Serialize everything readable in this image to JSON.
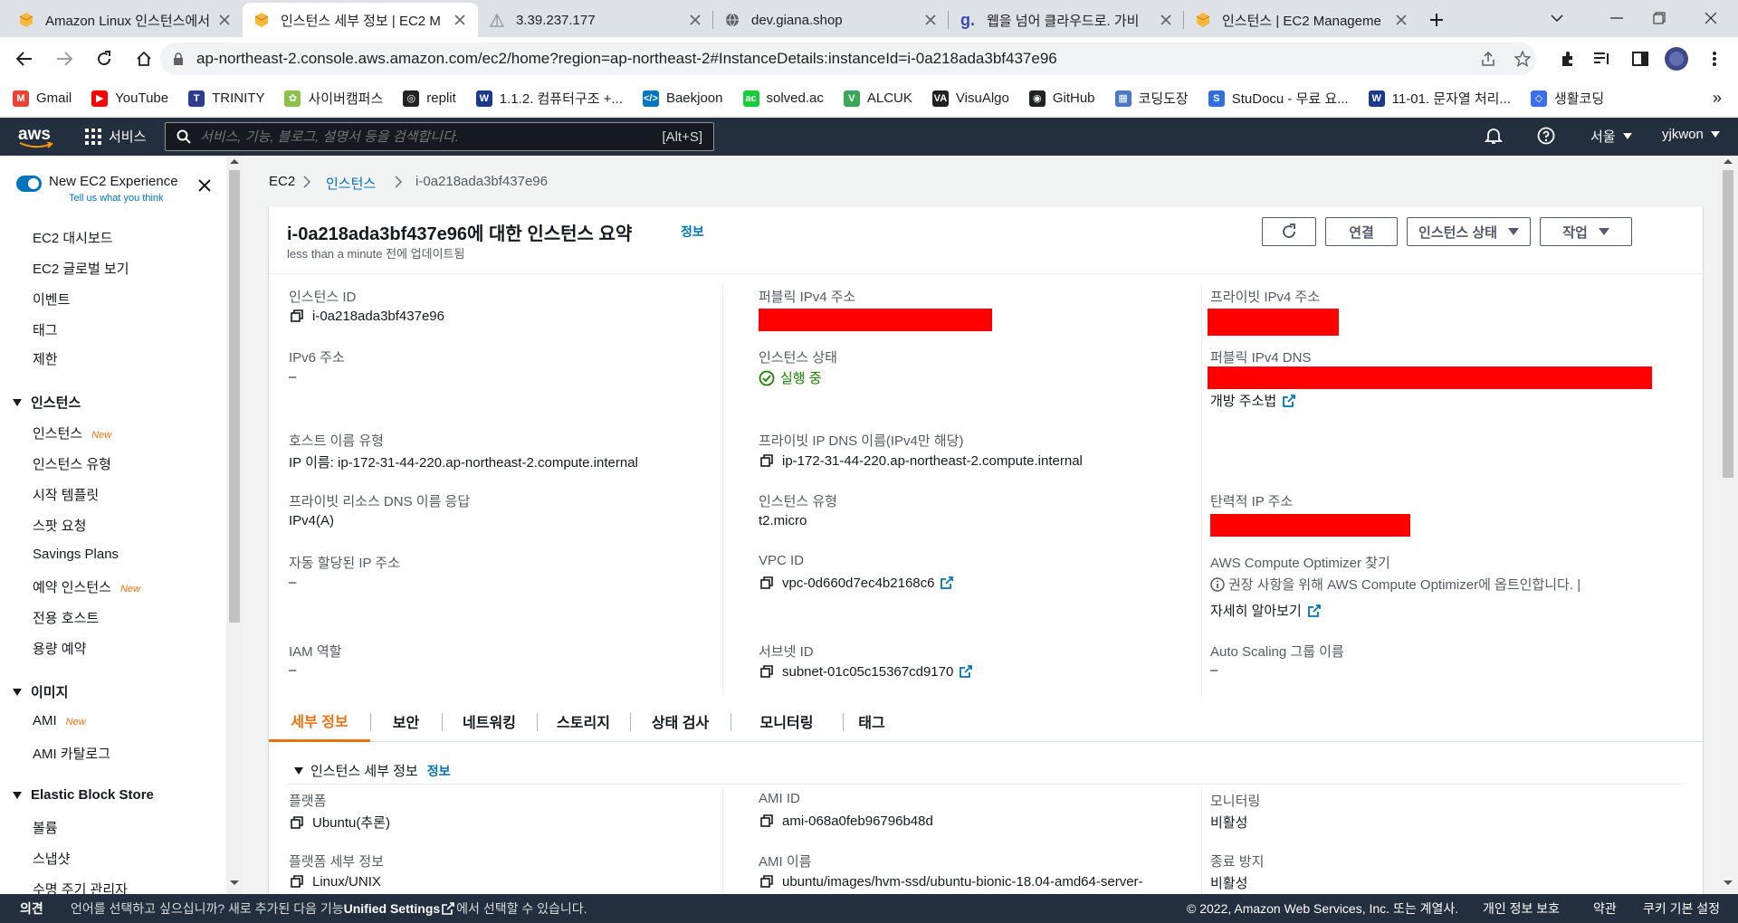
{
  "browser": {
    "tabs": [
      {
        "title": "Amazon Linux 인스턴스에서 A",
        "fav": "aws-box"
      },
      {
        "title": "인스턴스 세부 정보 | EC2 M",
        "fav": "aws-box"
      },
      {
        "title": "3.39.237.177",
        "fav": "tent"
      },
      {
        "title": "dev.giana.shop",
        "fav": "globe"
      },
      {
        "title": "웹을 넘어 클라우드로. 가비",
        "fav": "g"
      },
      {
        "title": "인스턴스 | EC2 Manageme",
        "fav": "aws-box"
      }
    ],
    "url": "ap-northeast-2.console.aws.amazon.com/ec2/home?region=ap-northeast-2#InstanceDetails:instanceId=i-0a218ada3bf437e96",
    "bookmarks": [
      {
        "label": "Gmail",
        "color": "#ea4335",
        "glyph": "M"
      },
      {
        "label": "YouTube",
        "color": "#ff0000",
        "glyph": "▶"
      },
      {
        "label": "TRINITY",
        "color": "#2c3e8c",
        "glyph": "T"
      },
      {
        "label": "사이버캠퍼스",
        "color": "#8bc34a",
        "glyph": "✿"
      },
      {
        "label": "replit",
        "color": "#202124",
        "glyph": "◎"
      },
      {
        "label": "1.1.2. 컴퓨터구조 +...",
        "color": "#1a3a8a",
        "glyph": "W"
      },
      {
        "label": "Baekjoon",
        "color": "#0076c0",
        "glyph": "</>"
      },
      {
        "label": "solved.ac",
        "color": "#17ce3a",
        "glyph": "ac"
      },
      {
        "label": "ALCUK",
        "color": "#3aa657",
        "glyph": "V"
      },
      {
        "label": "VisuAlgo",
        "color": "#202124",
        "glyph": "VA"
      },
      {
        "label": "GitHub",
        "color": "#202124",
        "glyph": "◉"
      },
      {
        "label": "코딩도장",
        "color": "#4a78c2",
        "glyph": "▦"
      },
      {
        "label": "StuDocu - 무료 요...",
        "color": "#2f6fdf",
        "glyph": "S"
      },
      {
        "label": "11-01. 문자열 처리...",
        "color": "#1a3a8a",
        "glyph": "W"
      },
      {
        "label": "생활코딩",
        "color": "#3d6ef0",
        "glyph": "◇"
      }
    ],
    "more_bookmarks": "»"
  },
  "aws": {
    "logo": "aws",
    "services": "서비스",
    "search_placeholder": "서비스, 기능, 블로그, 설명서 등을 검색합니다.",
    "search_shortcut": "[Alt+S]",
    "region": "서울",
    "user": "yjkwon"
  },
  "sidebar": {
    "new_experience": "New EC2 Experience",
    "tell_us": "Tell us what you think",
    "new_badge": "New",
    "items_top": [
      "EC2 대시보드",
      "EC2 글로벌 보기",
      "이벤트",
      "태그",
      "제한"
    ],
    "group_instances": "인스턴스",
    "items_instances": [
      "인스턴스",
      "인스턴스 유형",
      "시작 템플릿",
      "스팟 요청",
      "Savings Plans",
      "예약 인스턴스",
      "전용 호스트",
      "용량 예약"
    ],
    "group_images": "이미지",
    "items_images": [
      "AMI",
      "AMI 카탈로그"
    ],
    "group_ebs": "Elastic Block Store",
    "items_ebs": [
      "볼륨",
      "스냅샷",
      "수명 주기 관리자"
    ]
  },
  "breadcrumb": {
    "root": "EC2",
    "section": "인스턴스",
    "current": "i-0a218ada3bf437e96"
  },
  "summary": {
    "title": "i-0a218ada3bf437e96에 대한 인스턴스 요약",
    "info": "정보",
    "updated": "less than a minute 전에 업데이트됨",
    "btn_connect": "연결",
    "btn_state": "인스턴스 상태",
    "btn_actions": "작업"
  },
  "fields": {
    "instance_id_label": "인스턴스 ID",
    "instance_id": "i-0a218ada3bf437e96",
    "public_ipv4_label": "퍼블릭 IPv4 주소",
    "private_ipv4_label": "프라이빗 IPv4 주소",
    "ipv6_label": "IPv6 주소",
    "ipv6": "–",
    "state_label": "인스턴스 상태",
    "state": "실행 중",
    "public_dns_label": "퍼블릭 IPv4 DNS",
    "open_address": "개방 주소법",
    "hostname_type_label": "호스트 이름 유형",
    "hostname_type": "IP 이름: ip-172-31-44-220.ap-northeast-2.compute.internal",
    "private_dns_label": "프라이빗 IP DNS 이름(IPv4만 해당)",
    "private_dns": "ip-172-31-44-220.ap-northeast-2.compute.internal",
    "resource_dns_label": "프라이빗 리소스 DNS 이름 응답",
    "resource_dns": "IPv4(A)",
    "instance_type_label": "인스턴스 유형",
    "instance_type": "t2.micro",
    "elastic_ip_label": "탄력적 IP 주소",
    "auto_ip_label": "자동 할당된 IP 주소",
    "auto_ip": "–",
    "vpc_label": "VPC ID",
    "vpc": "vpc-0d660d7ec4b2168c6",
    "optimizer_label": "AWS Compute Optimizer 찾기",
    "optimizer_text": "권장 사항을 위해 AWS Compute Optimizer에 옵트인합니다. |",
    "learn_more": "자세히 알아보기",
    "iam_label": "IAM 역할",
    "iam": "–",
    "subnet_label": "서브넷 ID",
    "subnet": "subnet-01c05c15367cd9170",
    "asg_label": "Auto Scaling 그룹 이름",
    "asg": "–"
  },
  "detail_tabs": [
    "세부 정보",
    "보안",
    "네트워킹",
    "스토리지",
    "상태 검사",
    "모니터링",
    "태그"
  ],
  "details": {
    "section_title": "인스턴스 세부 정보",
    "info": "정보",
    "platform_label": "플랫폼",
    "platform": "Ubuntu(추론)",
    "ami_id_label": "AMI ID",
    "ami_id": "ami-068a0feb96796b48d",
    "monitoring_label": "모니터링",
    "monitoring": "비활성",
    "platform_details_label": "플랫폼 세부 정보",
    "platform_details": "Linux/UNIX",
    "ami_name_label": "AMI 이름",
    "ami_name": "ubuntu/images/hvm-ssd/ubuntu-bionic-18.04-amd64-server-",
    "termination_label": "종료 방지",
    "termination": "비활성"
  },
  "footer": {
    "feedback": "의견",
    "language_text": "언어를 선택하고 싶으십니까? 새로 추가된 다음 기능",
    "unified": "Unified Settings",
    "language_tail": "에서 선택할 수 있습니다.",
    "copyright": "© 2022, Amazon Web Services, Inc. 또는 계열사.",
    "privacy": "개인 정보 보호",
    "terms": "약관",
    "cookies": "쿠키 기본 설정"
  },
  "colors": {
    "aws_dark": "#232f3e",
    "link": "#0073bb",
    "accent": "#ec7211",
    "success": "#1d8102",
    "redaction": "#ff0000"
  }
}
